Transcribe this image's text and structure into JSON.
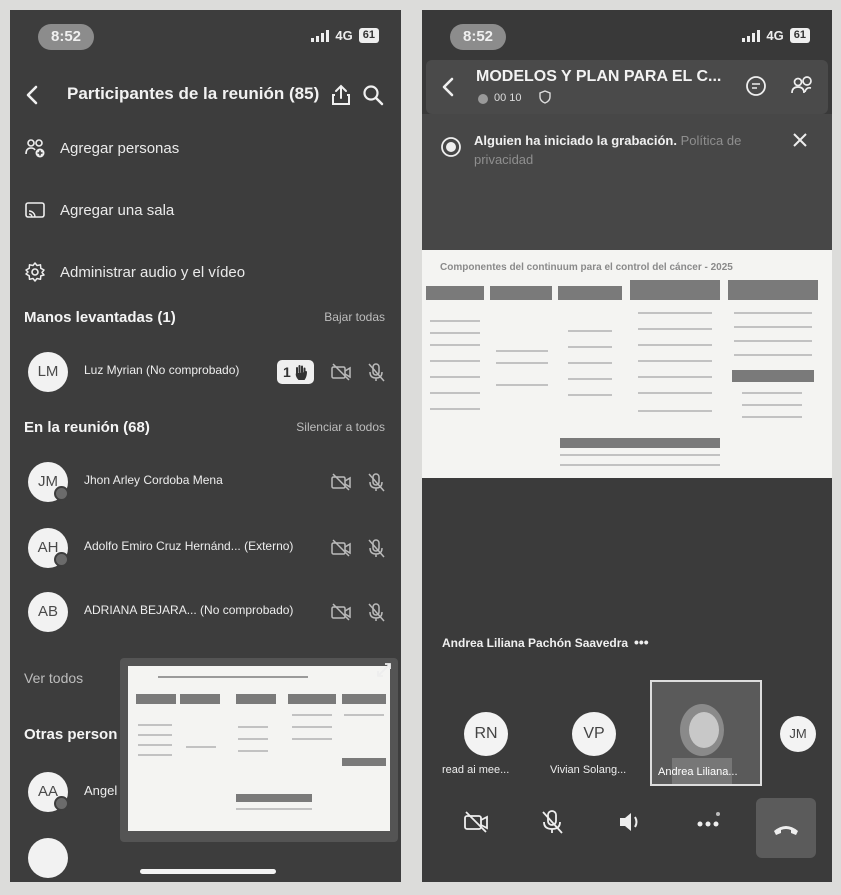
{
  "left": {
    "status": {
      "time": "8:52",
      "network": "4G",
      "battery": "61"
    },
    "header": {
      "title": "Participantes de la reunión (85)"
    },
    "menu": [
      {
        "label": "Agregar personas",
        "icon": "add-people-icon"
      },
      {
        "label": "Agregar una sala",
        "icon": "cast-room-icon"
      },
      {
        "label": "Administrar audio y el vídeo",
        "icon": "gear-icon"
      }
    ],
    "raised": {
      "heading": "Manos levantadas (1)",
      "action": "Bajar todas"
    },
    "raised_person": {
      "initials": "LM",
      "name": "Luz Myrian (No comprobado)",
      "hand_count": "1"
    },
    "in_meeting": {
      "heading": "En la reunión (68)",
      "action": "Silenciar a todos"
    },
    "participants": [
      {
        "initials": "JM",
        "name": "Jhon Arley Cordoba Mena"
      },
      {
        "initials": "AH",
        "name": "Adolfo Emiro Cruz Hernánd...  (Externo)"
      },
      {
        "initials": "AB",
        "name": "ADRIANA BEJARA...  (No comprobado)"
      }
    ],
    "see_all": "Ver todos",
    "others_heading": "Otras person",
    "other_person": {
      "initials": "AA",
      "name": "Angel"
    }
  },
  "right": {
    "status": {
      "time": "8:52",
      "network": "4G",
      "battery": "61"
    },
    "header": {
      "title": "MODELOS Y PLAN PARA EL C...",
      "timer": "00 10"
    },
    "banner": {
      "message": "Alguien ha iniciado la grabación.",
      "link": "Política de privacidad"
    },
    "slide": {
      "title": "Componentes del continuum para el control del cáncer - 2025"
    },
    "speaker": "Andrea Liliana Pachón Saavedra",
    "tiles": [
      {
        "initials": "RN",
        "label": "read ai mee..."
      },
      {
        "initials": "VP",
        "label": "Vivian Solang..."
      },
      {
        "initials": "",
        "label": "Andrea Liliana..."
      },
      {
        "initials": "JM",
        "label": ""
      }
    ]
  }
}
